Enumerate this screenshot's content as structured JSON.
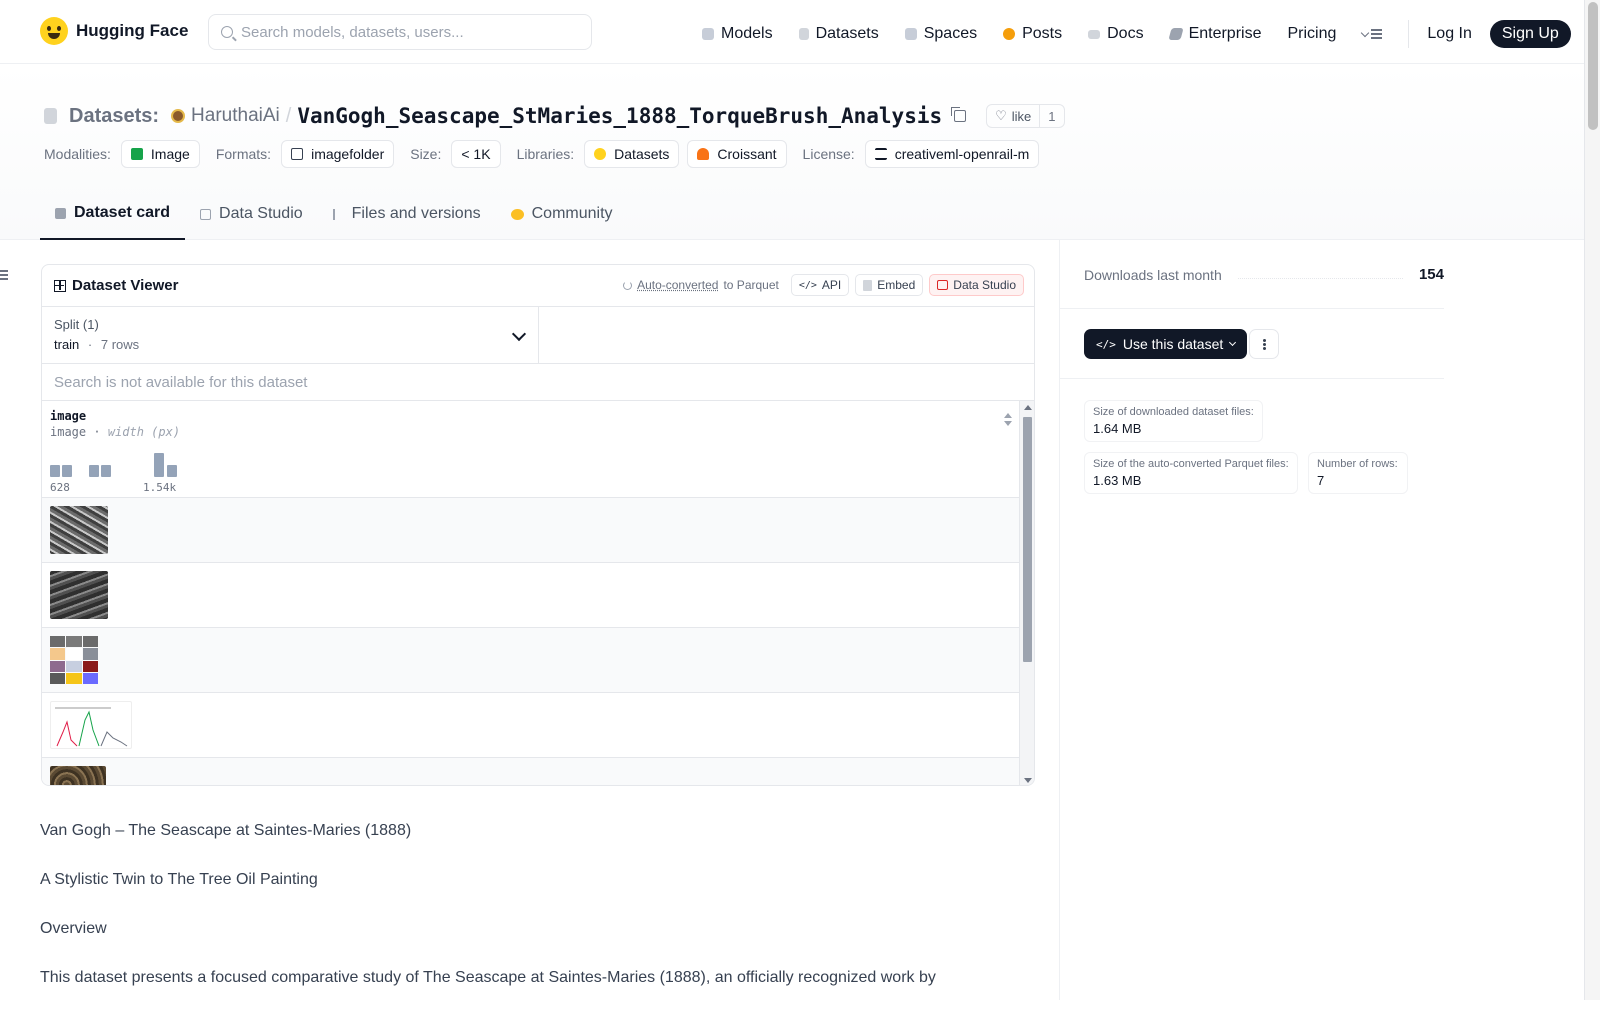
{
  "nav": {
    "brand": "Hugging Face",
    "search_placeholder": "Search models, datasets, users...",
    "links": [
      "Models",
      "Datasets",
      "Spaces",
      "Posts",
      "Docs",
      "Enterprise",
      "Pricing"
    ],
    "login": "Log In",
    "signup": "Sign Up"
  },
  "repo": {
    "type_label": "Datasets:",
    "owner": "HaruthaiAi",
    "name": "VanGogh_Seascape_StMaries_1888_TorqueBrush_Analysis",
    "like_label": "like",
    "like_count": "1"
  },
  "meta": {
    "modalities_label": "Modalities:",
    "modality": "Image",
    "formats_label": "Formats:",
    "format": "imagefolder",
    "size_label": "Size:",
    "size": "< 1K",
    "libraries_label": "Libraries:",
    "library_1": "Datasets",
    "library_2": "Croissant",
    "license_label": "License:",
    "license": "creativeml-openrail-m"
  },
  "tabs": [
    "Dataset card",
    "Data Studio",
    "Files and versions",
    "Community"
  ],
  "viewer": {
    "title": "Dataset Viewer",
    "auto_converted": "Auto-converted",
    "to_parquet": "to Parquet",
    "api": "API",
    "embed": "Embed",
    "data_studio": "Data Studio",
    "split_label": "Split (1)",
    "split_name": "train",
    "split_sep": "·",
    "split_rows": "7 rows",
    "search_na": "Search is not available for this dataset",
    "column_name": "image",
    "column_type": "image",
    "column_sep": "·",
    "column_hint": "width (px)",
    "hist_min": "628",
    "hist_max": "1.54k"
  },
  "prose": [
    "Van Gogh – The Seascape at Saintes-Maries (1888)",
    "A Stylistic Twin to The Tree Oil Painting",
    "Overview",
    "This dataset presents a focused comparative study of The Seascape at Saintes-Maries (1888), an officially recognized work by"
  ],
  "sidebar": {
    "downloads_label": "Downloads last month",
    "downloads_value": "154",
    "use_dataset": "Use this dataset",
    "size_downloaded_label": "Size of downloaded dataset files:",
    "size_downloaded_value": "1.64 MB",
    "size_parquet_label": "Size of the auto-converted Parquet files:",
    "size_parquet_value": "1.63 MB",
    "num_rows_label": "Number of rows:",
    "num_rows_value": "7"
  },
  "colors": {
    "brand_yellow": "#ffd21e",
    "dark": "#111827",
    "muted": "#6b7280"
  }
}
